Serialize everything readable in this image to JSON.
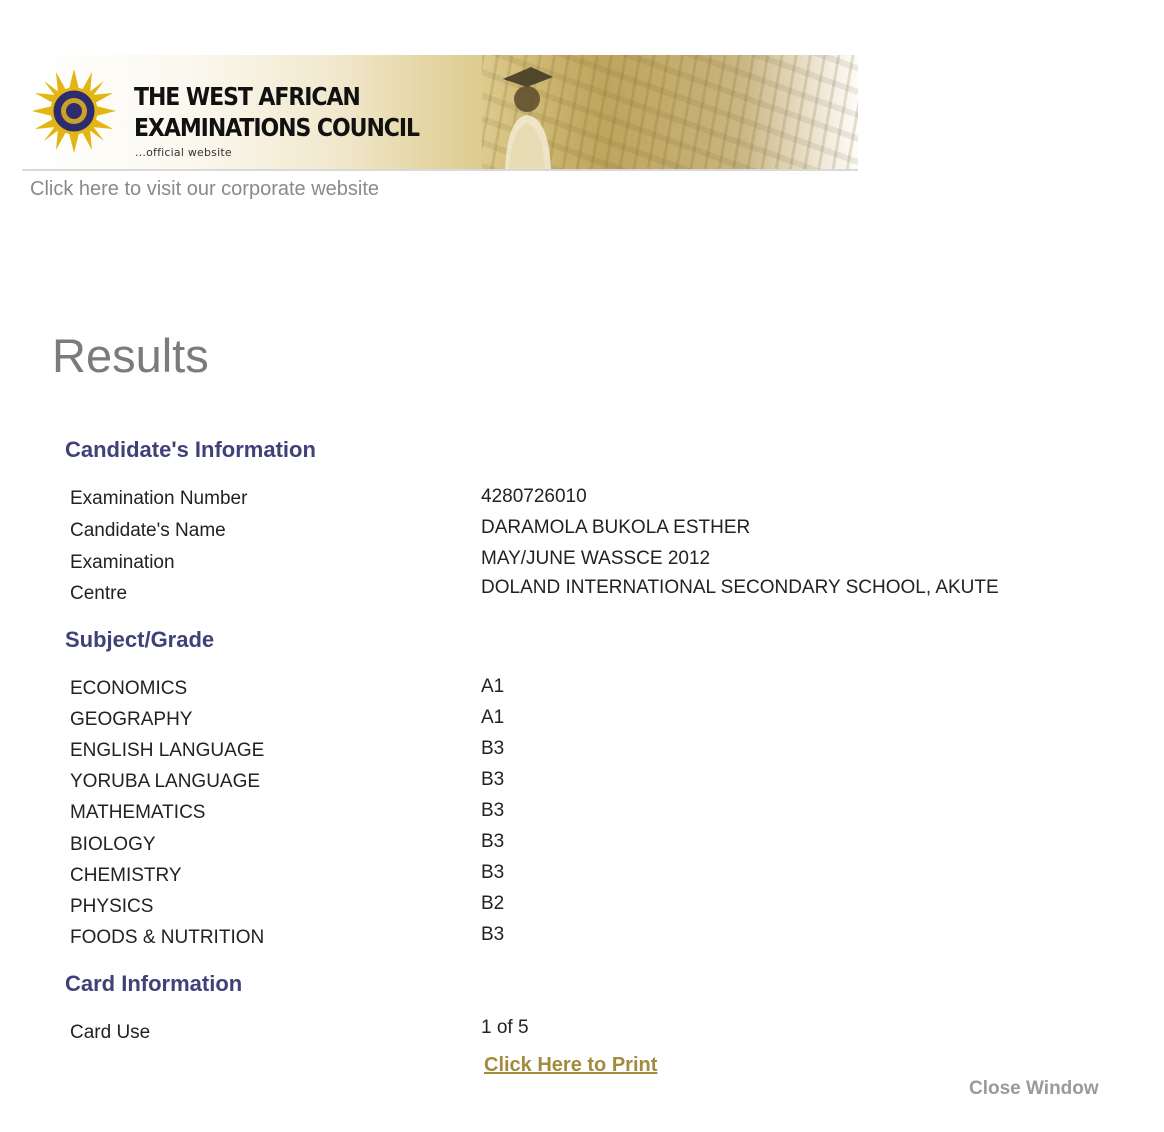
{
  "header": {
    "org_name_line1": "THE WEST AFRICAN",
    "org_name_line2": "EXAMINATIONS COUNCIL",
    "tagline": "...official website",
    "corporate_link": "Click here to visit our corporate website"
  },
  "page": {
    "title": "Results"
  },
  "candidate": {
    "heading": "Candidate's Information",
    "rows": [
      {
        "label": "Examination Number",
        "value": "4280726010"
      },
      {
        "label": "Candidate's Name",
        "value": "DARAMOLA BUKOLA ESTHER"
      },
      {
        "label": "Examination",
        "value": "MAY/JUNE WASSCE 2012"
      },
      {
        "label": "Centre",
        "value": "DOLAND INTERNATIONAL SECONDARY SCHOOL, AKUTE"
      }
    ]
  },
  "subjects": {
    "heading": "Subject/Grade",
    "rows": [
      {
        "subject": "ECONOMICS",
        "grade": "A1"
      },
      {
        "subject": "GEOGRAPHY",
        "grade": "A1"
      },
      {
        "subject": "ENGLISH LANGUAGE",
        "grade": "B3"
      },
      {
        "subject": "YORUBA LANGUAGE",
        "grade": "B3"
      },
      {
        "subject": "MATHEMATICS",
        "grade": "B3"
      },
      {
        "subject": "BIOLOGY",
        "grade": "B3"
      },
      {
        "subject": "CHEMISTRY",
        "grade": "B3"
      },
      {
        "subject": "PHYSICS",
        "grade": "B2"
      },
      {
        "subject": "FOODS & NUTRITION",
        "grade": "B3"
      }
    ]
  },
  "card": {
    "heading": "Card Information",
    "rows": [
      {
        "label": "Card Use",
        "value": "1 of 5"
      }
    ],
    "print_link": "Click Here to Print"
  },
  "footer": {
    "close_window": "Close Window"
  },
  "colors": {
    "heading": "#41417a",
    "print_link": "#a08c3c",
    "muted": "#8a8a8a",
    "banner_gold": "#d8c47f"
  }
}
